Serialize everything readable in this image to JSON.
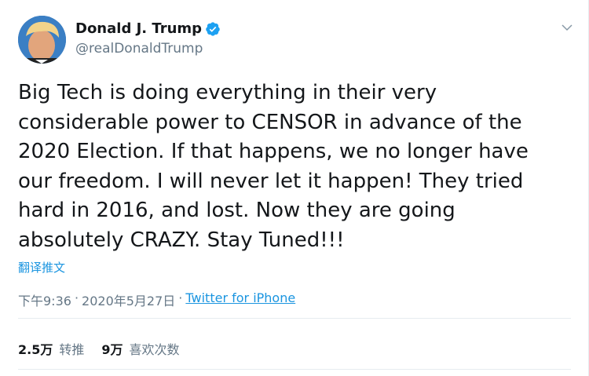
{
  "user": {
    "display_name": "Donald J. Trump",
    "handle": "@realDonaldTrump",
    "verified_icon": "verified-badge-icon",
    "avatar_icon": "user-avatar"
  },
  "menu": {
    "caret_icon": "chevron-down-icon"
  },
  "tweet": {
    "text": "Big Tech is doing everything in their very\nconsiderable power to CENSOR in advance of the\n2020 Election. If that happens, we no longer have\nour freedom. I will never let it happen! They tried\nhard in 2016, and lost. Now they are going\nabsolutely CRAZY. Stay Tuned!!!",
    "translate_label": "翻译推文"
  },
  "meta": {
    "time": "下午9:36",
    "separator1": "·",
    "date": "2020年5月27日",
    "separator2": "·",
    "source": "Twitter for iPhone"
  },
  "stats": {
    "retweets_count": "2.5万",
    "retweets_label": "转推",
    "likes_count": "9万",
    "likes_label": "喜欢次数"
  },
  "colors": {
    "link": "#1b95e0",
    "secondary_text": "#657786",
    "divider": "#e6ecf0",
    "verified": "#1da1f2"
  }
}
